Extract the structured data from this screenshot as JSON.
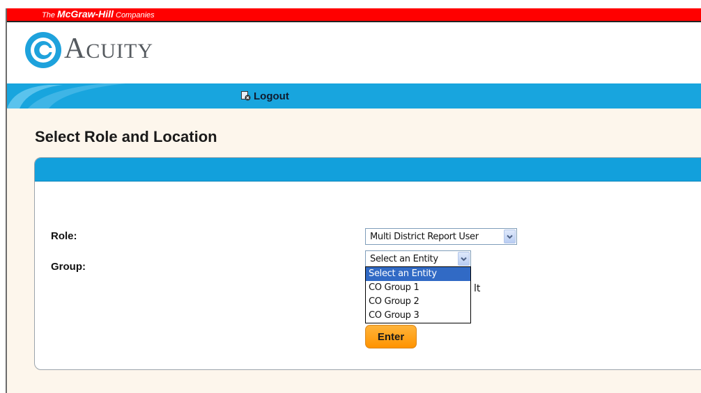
{
  "brand_bar": {
    "prefix": "The",
    "name": "McGraw-Hill",
    "suffix": "Companies"
  },
  "logo": {
    "first_letter": "A",
    "rest": "CUITY"
  },
  "nav": {
    "logout_label": "Logout"
  },
  "page": {
    "title": "Select Role and Location"
  },
  "form": {
    "role_label": "Role:",
    "role_value": "Multi District Report User",
    "group_label": "Group:",
    "group_value": "Select an Entity",
    "group_options": [
      "Select an Entity",
      "CO Group 1",
      "CO Group 2",
      "CO Group 3"
    ],
    "selected_option_index": 0,
    "obscured_text_fragment": "lt",
    "enter_label": "Enter"
  },
  "colors": {
    "brand_red": "#ff0000",
    "nav_blue": "#18a5de",
    "panel_header_blue": "#12a0dc",
    "content_bg": "#fdf6ec",
    "enter_orange": "#ff9f1a",
    "selection_blue": "#316ac5"
  },
  "icons": [
    "acuity-logo-icon",
    "logout-icon",
    "chevron-down-icon"
  ]
}
